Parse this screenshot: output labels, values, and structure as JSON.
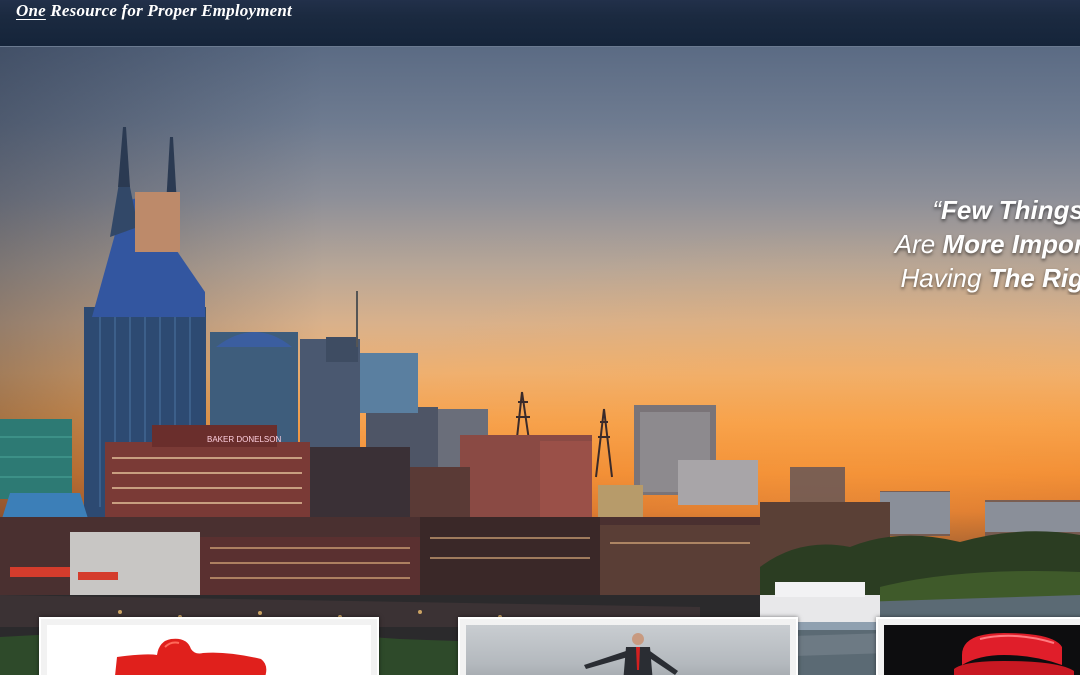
{
  "header": {
    "tagline_emphasis": "One",
    "tagline_rest": " Resource for Proper Employment"
  },
  "hero": {
    "quote_lines": [
      {
        "plain": "“",
        "bold": "Few Things"
      },
      {
        "plain": "Are ",
        "bold": "More Impor"
      },
      {
        "plain": "Having ",
        "bold": "The Rig"
      }
    ],
    "building_sign": "BAKER DONELSON"
  },
  "cards": [
    {
      "image": "red-puzzle-piece-icon"
    },
    {
      "image": "businessman-balancing-photo"
    },
    {
      "image": "red-telephone-photo"
    }
  ],
  "colors": {
    "header_bg": "#1b2a40",
    "sunset_orange": "#f08a33",
    "accent_red": "#e0201c"
  }
}
